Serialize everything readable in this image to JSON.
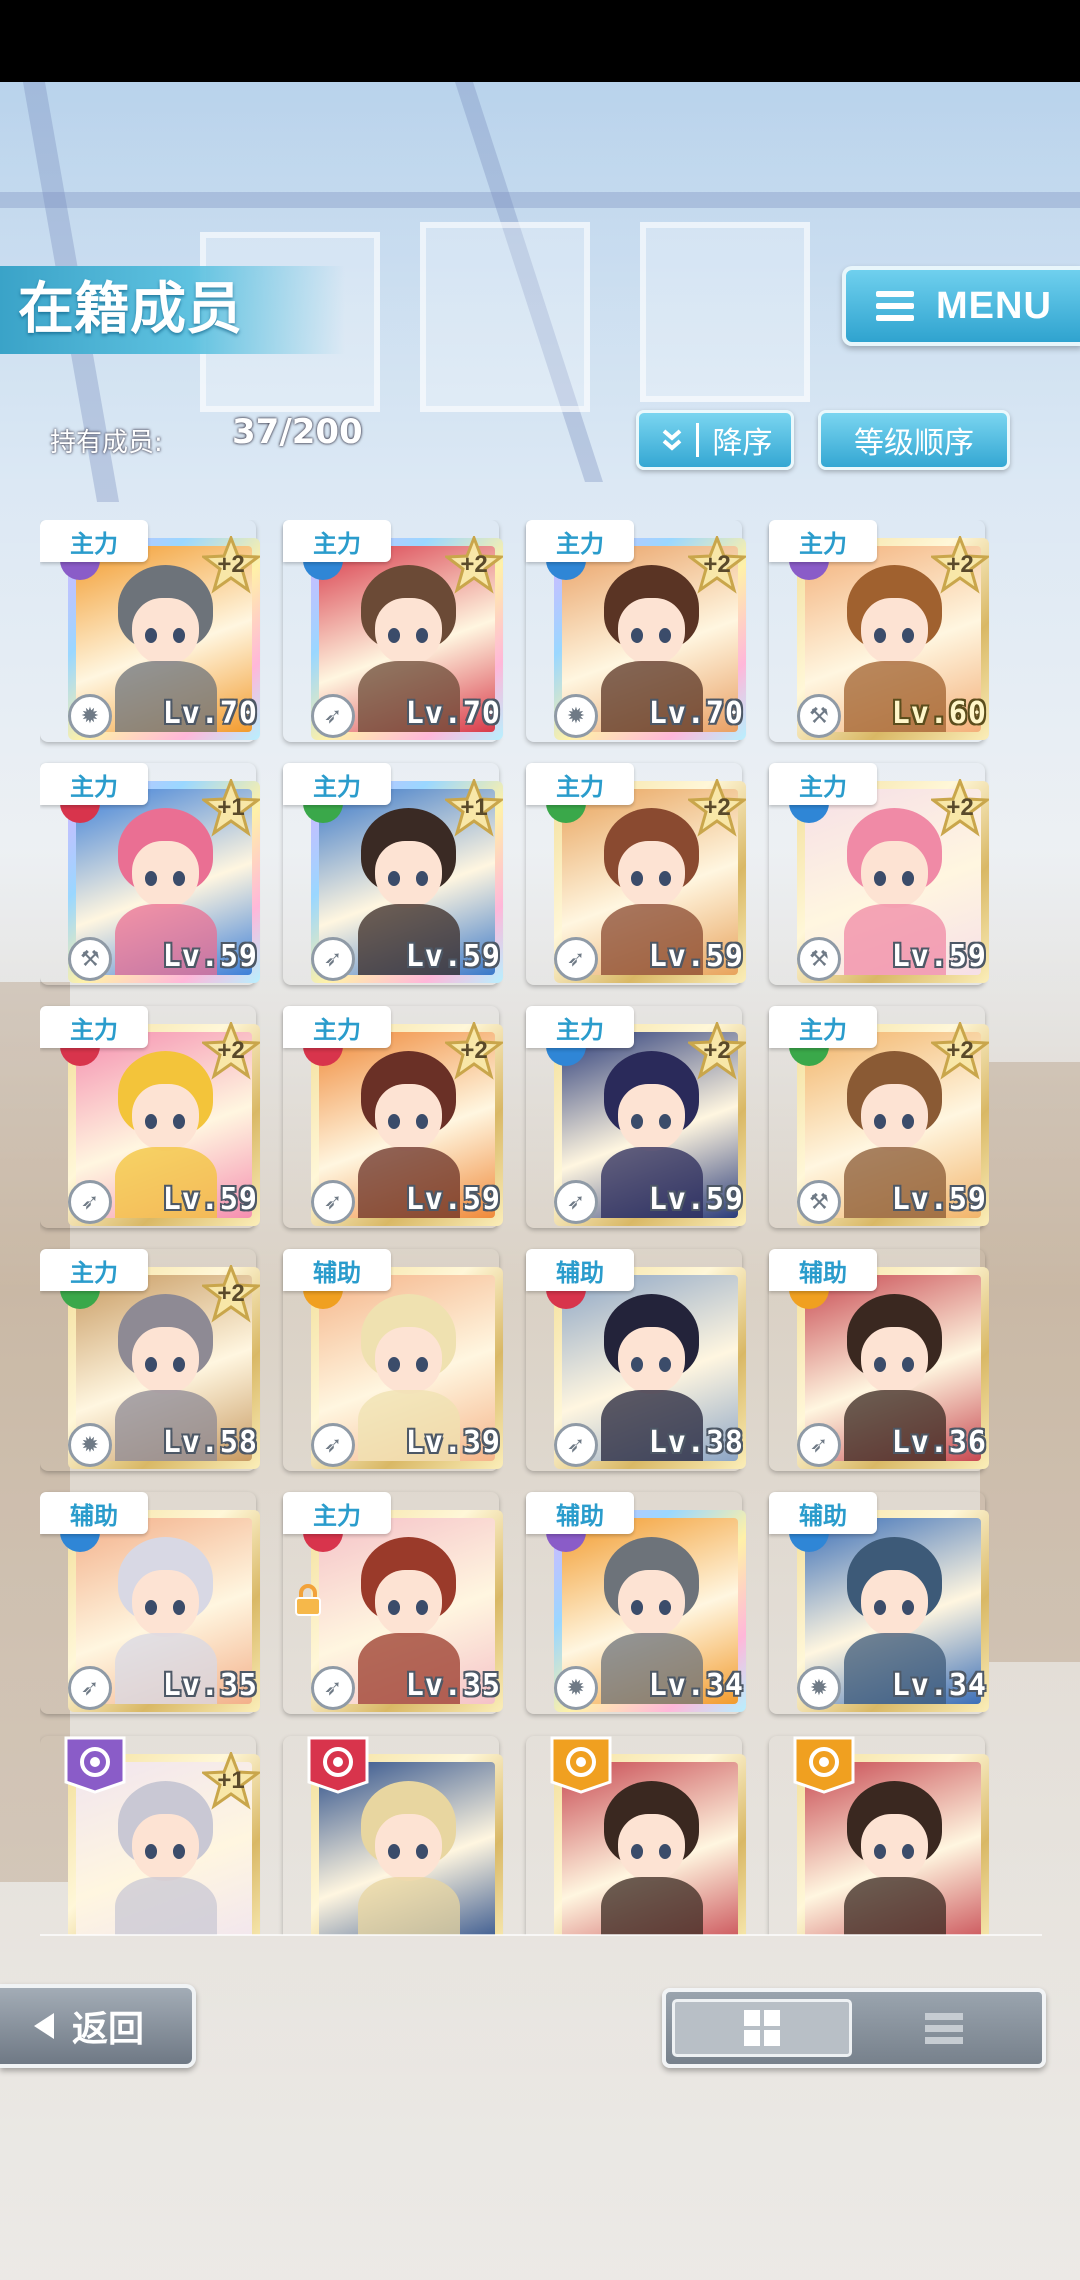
{
  "header": {
    "title": "在籍成员",
    "menu_label": "MENU"
  },
  "summary": {
    "owned_label": "持有成员:",
    "owned_count": "37/200"
  },
  "sort": {
    "order_label": "降序",
    "key_label": "等级顺序"
  },
  "cards": [
    {
      "role": "主力",
      "plus": "+2",
      "level": "Lv.70",
      "frame": "rainbow",
      "attr_color": "#8a5cc8",
      "type_icon": "gear-icon",
      "hair": "#6d737a",
      "bg": "#f29b2e"
    },
    {
      "role": "主力",
      "plus": "+2",
      "level": "Lv.70",
      "frame": "rainbow",
      "attr_color": "#2f86d6",
      "type_icon": "feather-icon",
      "hair": "#6b4a36",
      "bg": "#d83a4a"
    },
    {
      "role": "主力",
      "plus": "+2",
      "level": "Lv.70",
      "frame": "rainbow",
      "attr_color": "#2f86d6",
      "type_icon": "gear-icon",
      "hair": "#5a3424",
      "bg": "#e9a064"
    },
    {
      "role": "主力",
      "plus": "+2",
      "level": "Lv.60",
      "frame": "gold",
      "attr_color": "#8a5cc8",
      "type_icon": "hammer-icon",
      "hair": "#a0612f",
      "bg": "#f3b07a",
      "level_gold": true
    },
    {
      "role": "主力",
      "plus": "+1",
      "level": "Lv.59",
      "frame": "rainbow",
      "attr_color": "#d8344c",
      "type_icon": "hammer-icon",
      "hair": "#ea6f93",
      "bg": "#3d7fd8"
    },
    {
      "role": "主力",
      "plus": "+1",
      "level": "Lv.59",
      "frame": "rainbow",
      "attr_color": "#3aa84a",
      "type_icon": "feather-icon",
      "hair": "#3a2a24",
      "bg": "#3a78c9"
    },
    {
      "role": "主力",
      "plus": "+2",
      "level": "Lv.59",
      "frame": "gold",
      "attr_color": "#3aa84a",
      "type_icon": "feather-icon",
      "hair": "#8a4a30",
      "bg": "#e8a35c"
    },
    {
      "role": "主力",
      "plus": "+2",
      "level": "Lv.59",
      "frame": "gold",
      "attr_color": "#2f86d6",
      "type_icon": "hammer-icon",
      "hair": "#f08aa6",
      "bg": "#f6dfe7"
    },
    {
      "role": "主力",
      "plus": "+2",
      "level": "Lv.59",
      "frame": "gold",
      "attr_color": "#d8344c",
      "type_icon": "feather-icon",
      "hair": "#f3c43a",
      "bg": "#f58fb0"
    },
    {
      "role": "主力",
      "plus": "+2",
      "level": "Lv.59",
      "frame": "gold",
      "attr_color": "#d8344c",
      "type_icon": "feather-icon",
      "hair": "#6a3026",
      "bg": "#f08a3a"
    },
    {
      "role": "主力",
      "plus": "+2",
      "level": "Lv.59",
      "frame": "gold",
      "attr_color": "#2f86d6",
      "type_icon": "feather-icon",
      "hair": "#2a2a5a",
      "bg": "#2b3c7a"
    },
    {
      "role": "主力",
      "plus": "+2",
      "level": "Lv.59",
      "frame": "gold",
      "attr_color": "#3aa84a",
      "type_icon": "hammer-icon",
      "hair": "#8a5a34",
      "bg": "#f2b46a"
    },
    {
      "role": "主力",
      "plus": "+2",
      "level": "Lv.58",
      "frame": "gold",
      "attr_color": "#3aa84a",
      "type_icon": "gear-icon",
      "hair": "#8e8a94",
      "bg": "#c89b62"
    },
    {
      "role": "辅助",
      "plus": "",
      "level": "Lv.39",
      "frame": "gold",
      "attr_color": "#f0a020",
      "type_icon": "feather-icon",
      "hair": "#efe1b0",
      "bg": "#f5b58a"
    },
    {
      "role": "辅助",
      "plus": "",
      "level": "Lv.38",
      "frame": "gold",
      "attr_color": "#d8344c",
      "type_icon": "feather-icon",
      "hair": "#23233a",
      "bg": "#8da6c6"
    },
    {
      "role": "辅助",
      "plus": "",
      "level": "Lv.36",
      "frame": "gold",
      "attr_color": "#f0a020",
      "type_icon": "feather-icon",
      "hair": "#3a2820",
      "bg": "#c84a52"
    },
    {
      "role": "辅助",
      "plus": "",
      "level": "Lv.35",
      "frame": "gold",
      "attr_color": "#2f86d6",
      "type_icon": "feather-icon",
      "hair": "#d8d8e4",
      "bg": "#f3b08a"
    },
    {
      "role": "主力",
      "plus": "",
      "level": "Lv.35",
      "frame": "gold",
      "attr_color": "#d8344c",
      "type_icon": "feather-icon",
      "hair": "#9a3a2a",
      "bg": "#f5c2c8",
      "locked": true
    },
    {
      "role": "辅助",
      "plus": "",
      "level": "Lv.34",
      "frame": "rainbow",
      "attr_color": "#8a5cc8",
      "type_icon": "gear-icon",
      "hair": "#6d737a",
      "bg": "#f29b2e"
    },
    {
      "role": "辅助",
      "plus": "",
      "level": "Lv.34",
      "frame": "gold",
      "attr_color": "#2f86d6",
      "type_icon": "gear-icon",
      "hair": "#3d5a78",
      "bg": "#3b6fb8"
    },
    {
      "role": "",
      "plus": "+1",
      "level": "",
      "frame": "gold",
      "attr_color": "#8a5cc8",
      "type_icon": "",
      "hair": "#c9c8d4",
      "bg": "#f1e5ef",
      "banner": true
    },
    {
      "role": "",
      "plus": "",
      "level": "",
      "frame": "gold",
      "attr_color": "#d8344c",
      "type_icon": "",
      "hair": "#e8d6a0",
      "bg": "#2d4f8a",
      "banner": true
    },
    {
      "role": "",
      "plus": "",
      "level": "",
      "frame": "gold",
      "attr_color": "#f0a020",
      "type_icon": "",
      "hair": "#3a2820",
      "bg": "#c84a52",
      "banner": true
    },
    {
      "role": "",
      "plus": "",
      "level": "",
      "frame": "gold",
      "attr_color": "#f0a020",
      "type_icon": "",
      "hair": "#3a2820",
      "bg": "#c84a52",
      "banner": true
    }
  ],
  "footer": {
    "back_label": "返回"
  },
  "colors": {
    "accent": "#34a7d3",
    "role_text": "#2a9ccc"
  }
}
